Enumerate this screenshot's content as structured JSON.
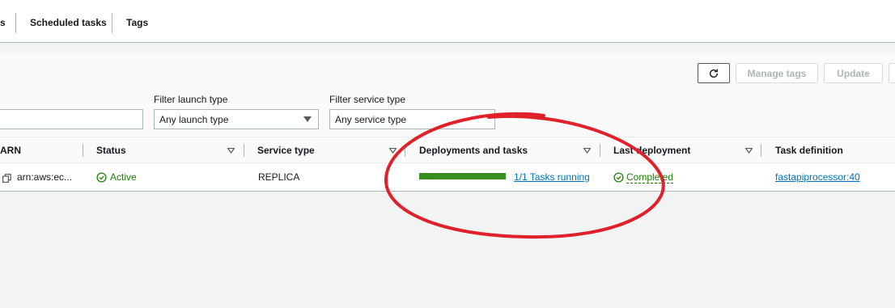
{
  "tabs": [
    {
      "label": "s"
    },
    {
      "label": "Scheduled tasks"
    },
    {
      "label": "Tags"
    }
  ],
  "toolbar": {
    "manage_tags": "Manage tags",
    "update": "Update"
  },
  "filters": {
    "launch_type_label": "Filter launch type",
    "launch_type_value": "Any launch type",
    "service_type_label": "Filter service type",
    "service_type_value": "Any service type"
  },
  "table": {
    "columns": [
      "ARN",
      "Status",
      "Service type",
      "Deployments and tasks",
      "Last deployment",
      "Task definition"
    ],
    "rows": [
      {
        "arn": "arn:aws:ec...",
        "status": "Active",
        "service_type": "REPLICA",
        "tasks_running": "1/1 Tasks running",
        "tasks_progress_fraction": 1.0,
        "last_deployment": "Completed",
        "task_definition": "fastapiprocessor:40"
      }
    ]
  },
  "colors": {
    "success": "#1d8102",
    "link": "#0073bb",
    "annotation": "#e0212a"
  },
  "icons": [
    "refresh-icon",
    "copy-icon",
    "check-circle-icon",
    "sort-caret-icon",
    "dropdown-caret-icon"
  ]
}
